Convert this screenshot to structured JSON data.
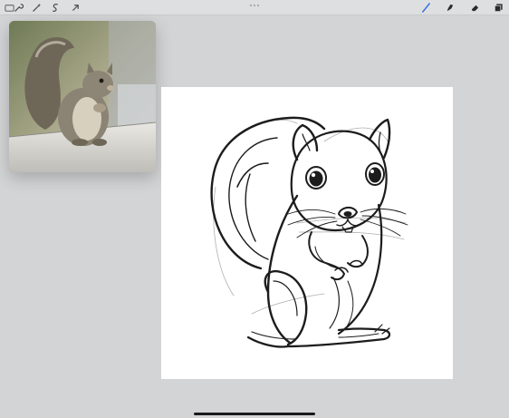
{
  "toolbar": {
    "left_tools": [
      "wrench-icon",
      "magic-wand-icon",
      "selection-icon",
      "transform-arrow-icon"
    ],
    "right_tools": [
      "brush-icon",
      "smudge-icon",
      "eraser-icon",
      "layers-icon"
    ],
    "active_tool": "brush",
    "accent_color": "#2f6fe0"
  },
  "reference": {
    "subject": "squirrel-photo"
  },
  "canvas": {
    "background": "#ffffff",
    "stroke_color": "#1c1c1c"
  }
}
